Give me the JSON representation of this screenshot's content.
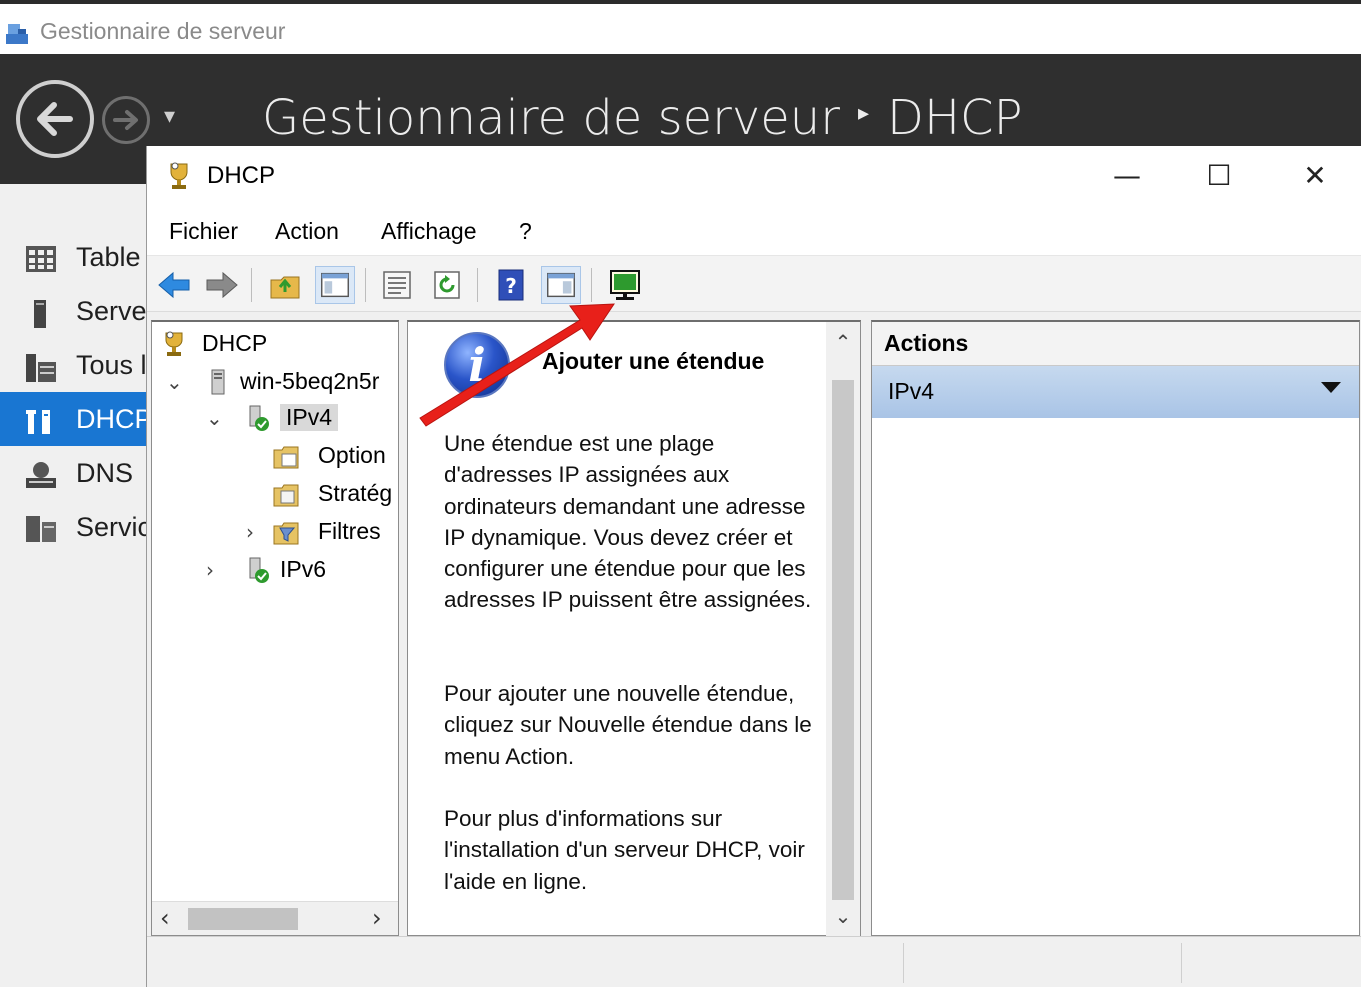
{
  "server_manager": {
    "window_title": "Gestionnaire de serveur",
    "breadcrumb": [
      "Gestionnaire de serveur",
      "DHCP"
    ],
    "sidebar": [
      {
        "label": "Table",
        "icon": "dashboard-icon"
      },
      {
        "label": "Serve",
        "icon": "local-server-icon"
      },
      {
        "label": "Tous l",
        "icon": "all-servers-icon"
      },
      {
        "label": "DHCP",
        "icon": "dhcp-role-icon",
        "selected": true
      },
      {
        "label": "DNS",
        "icon": "dns-role-icon"
      },
      {
        "label": "Servic",
        "icon": "file-services-icon"
      }
    ]
  },
  "dhcp_window": {
    "title": "DHCP",
    "controls": {
      "minimize": "—",
      "maximize": "☐",
      "close": "✕"
    },
    "menu": [
      "Fichier",
      "Action",
      "Affichage",
      "?"
    ],
    "tree": {
      "root": "DHCP",
      "server": "win-5beq2n5r",
      "ipv4": "IPv4",
      "ipv4_children": [
        "Option",
        "Stratég",
        "Filtres"
      ],
      "ipv6": "IPv6"
    },
    "center": {
      "title": "Ajouter une étendue",
      "paragraphs": [
        "Une étendue est une plage d'adresses IP assignées aux ordinateurs demandant une adresse IP dynamique. Vous devez créer et configurer une étendue pour que les adresses IP puissent être assignées.",
        "Pour ajouter une nouvelle étendue, cliquez sur Nouvelle étendue dans le menu Action.",
        "Pour plus d'informations sur l'installation d'un serveur DHCP, voir l'aide en ligne."
      ]
    },
    "actions": {
      "header": "Actions",
      "selected": "IPv4"
    }
  },
  "colors": {
    "sidebar_selected": "#1976d2",
    "header_dark": "#2f2f2f",
    "arrow_red": "#e8201a"
  }
}
